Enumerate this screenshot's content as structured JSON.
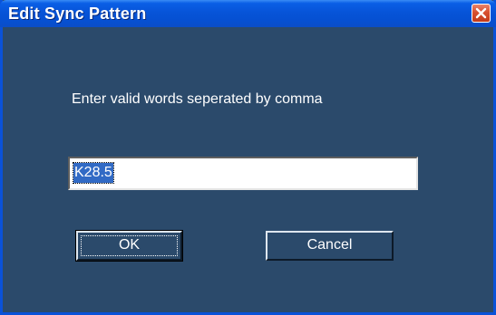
{
  "window": {
    "title": "Edit Sync Pattern"
  },
  "dialog": {
    "prompt": "Enter valid words seperated by comma",
    "input_value": "K28.5",
    "ok_label": "OK",
    "cancel_label": "Cancel"
  },
  "colors": {
    "title_bar": "#0754d8",
    "client_background": "#2b4a6b",
    "close_button": "#d8502f",
    "selection": "#316ac5"
  },
  "icons": {
    "close": "close-icon"
  }
}
